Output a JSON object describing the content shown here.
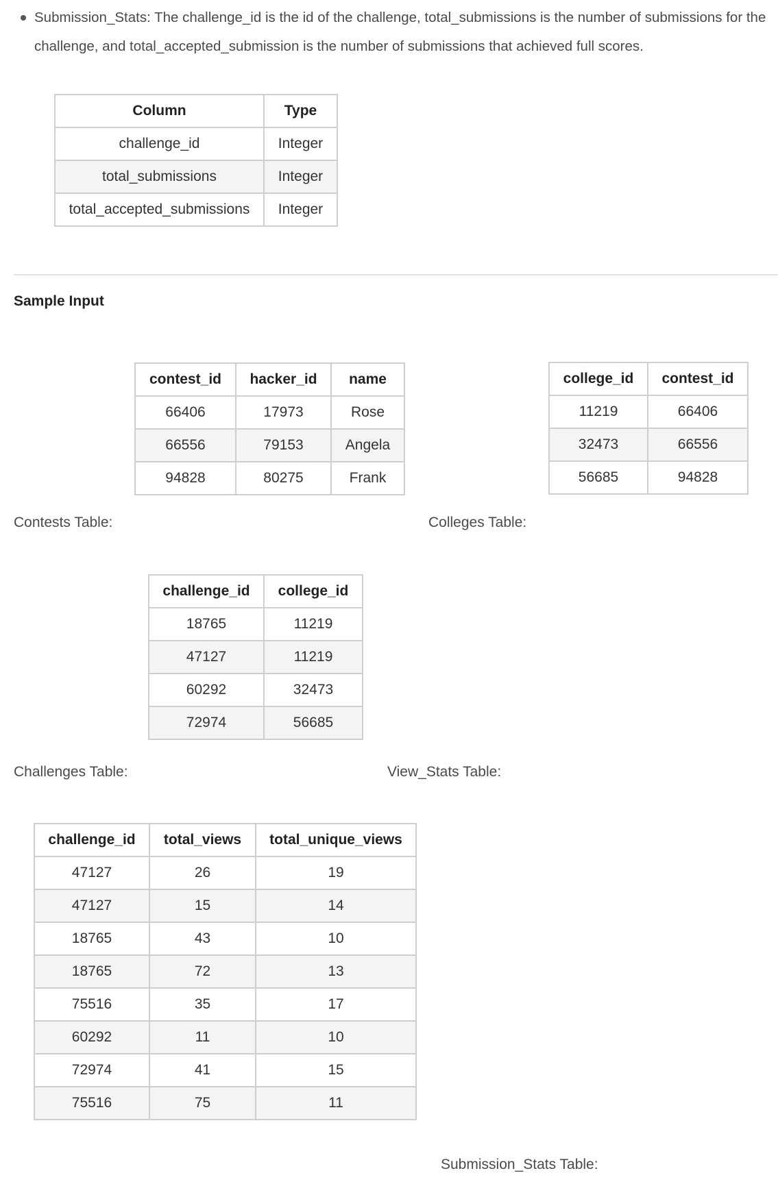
{
  "intro": {
    "text": "Submission_Stats: The challenge_id is the id of the challenge, total_submissions is the number of submissions for the challenge, and total_accepted_submission is the number of submissions that achieved full scores."
  },
  "schema_table": {
    "headers": [
      "Column",
      "Type"
    ],
    "rows": [
      [
        "challenge_id",
        "Integer"
      ],
      [
        "total_submissions",
        "Integer"
      ],
      [
        "total_accepted_submissions",
        "Integer"
      ]
    ]
  },
  "section_heading": "Sample Input",
  "contests": {
    "caption": "Contests Table:",
    "headers": [
      "contest_id",
      "hacker_id",
      "name"
    ],
    "rows": [
      [
        "66406",
        "17973",
        "Rose"
      ],
      [
        "66556",
        "79153",
        "Angela"
      ],
      [
        "94828",
        "80275",
        "Frank"
      ]
    ]
  },
  "colleges": {
    "caption": "Colleges Table:",
    "headers": [
      "college_id",
      "contest_id"
    ],
    "rows": [
      [
        "11219",
        "66406"
      ],
      [
        "32473",
        "66556"
      ],
      [
        "56685",
        "94828"
      ]
    ]
  },
  "challenges": {
    "caption": "Challenges Table:",
    "headers": [
      "challenge_id",
      "college_id"
    ],
    "rows": [
      [
        "18765",
        "11219"
      ],
      [
        "47127",
        "11219"
      ],
      [
        "60292",
        "32473"
      ],
      [
        "72974",
        "56685"
      ]
    ]
  },
  "view_stats": {
    "caption": "View_Stats Table:",
    "headers": [
      "challenge_id",
      "total_views",
      "total_unique_views"
    ],
    "rows": [
      [
        "47127",
        "26",
        "19"
      ],
      [
        "47127",
        "15",
        "14"
      ],
      [
        "18765",
        "43",
        "10"
      ],
      [
        "18765",
        "72",
        "13"
      ],
      [
        "75516",
        "35",
        "17"
      ],
      [
        "60292",
        "11",
        "10"
      ],
      [
        "72974",
        "41",
        "15"
      ],
      [
        "75516",
        "75",
        "11"
      ]
    ]
  },
  "submission_stats": {
    "caption": "Submission_Stats Table:"
  }
}
